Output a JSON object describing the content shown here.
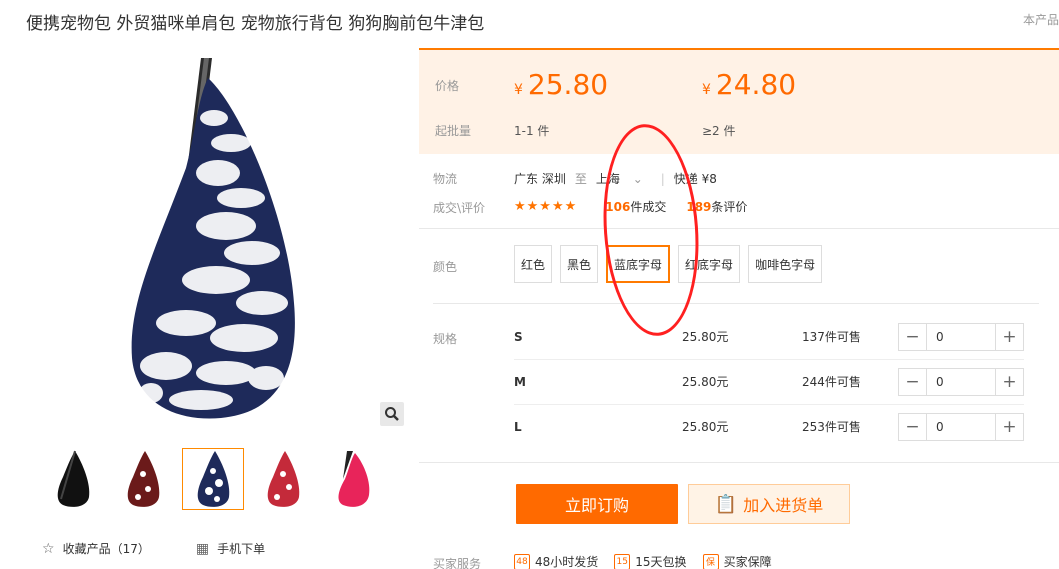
{
  "product": {
    "title": "便携宠物包 外贸猫咪单肩包 宠物旅行背包 狗狗胸前包牛津包",
    "right_note": "本产品"
  },
  "gallery": {
    "zoom_icon": "magnifier-icon",
    "thumbnails": [
      "black bag",
      "brown letters bag",
      "navy letters bag",
      "red letters bag",
      "pink bag"
    ],
    "active_index": 2
  },
  "actions_left": {
    "favorite": "收藏产品（17）",
    "favorite_icon": "star-outline-icon",
    "mobile": "手机下单",
    "mobile_icon": "qrcode-icon"
  },
  "pricing": {
    "price_label": "价格",
    "qty_label": "起批量",
    "currency": "¥",
    "tiers": [
      {
        "price": "25.80",
        "qty": "1-1 件"
      },
      {
        "price": "24.80",
        "qty": "≥2 件"
      }
    ]
  },
  "logistics": {
    "label": "物流",
    "from": "广东 深圳",
    "to_word": "至",
    "dest": "上海",
    "express": "快递 ¥8"
  },
  "deals": {
    "label": "成交\\评价",
    "stars": "★★★★★",
    "sold_count": "106",
    "sold_suffix": "件成交",
    "review_count": "189",
    "review_suffix": "条评价"
  },
  "color": {
    "label": "颜色",
    "options": [
      "红色",
      "黑色",
      "蓝底字母",
      "红底字母",
      "咖啡色字母"
    ],
    "selected_index": 2
  },
  "spec": {
    "label": "规格",
    "rows": [
      {
        "size": "S",
        "price": "25.80元",
        "stock": "137件可售",
        "qty": "0"
      },
      {
        "size": "M",
        "price": "25.80元",
        "stock": "244件可售",
        "qty": "0"
      },
      {
        "size": "L",
        "price": "25.80元",
        "stock": "253件可售",
        "qty": "0"
      }
    ],
    "minus": "−",
    "plus": "+"
  },
  "buttons": {
    "buy": "立即订购",
    "cart": "加入进货单",
    "cart_icon": "clipboard-icon"
  },
  "services": {
    "label": "买家服务",
    "items": [
      {
        "icon": "48",
        "text": "48小时发货"
      },
      {
        "icon": "15",
        "text": "15天包换"
      },
      {
        "icon": "保",
        "text": "买家保障"
      }
    ]
  },
  "colors": {
    "accent": "#ff6a00",
    "price_bg": "#fff2e6",
    "annotation": "#ff2020"
  }
}
